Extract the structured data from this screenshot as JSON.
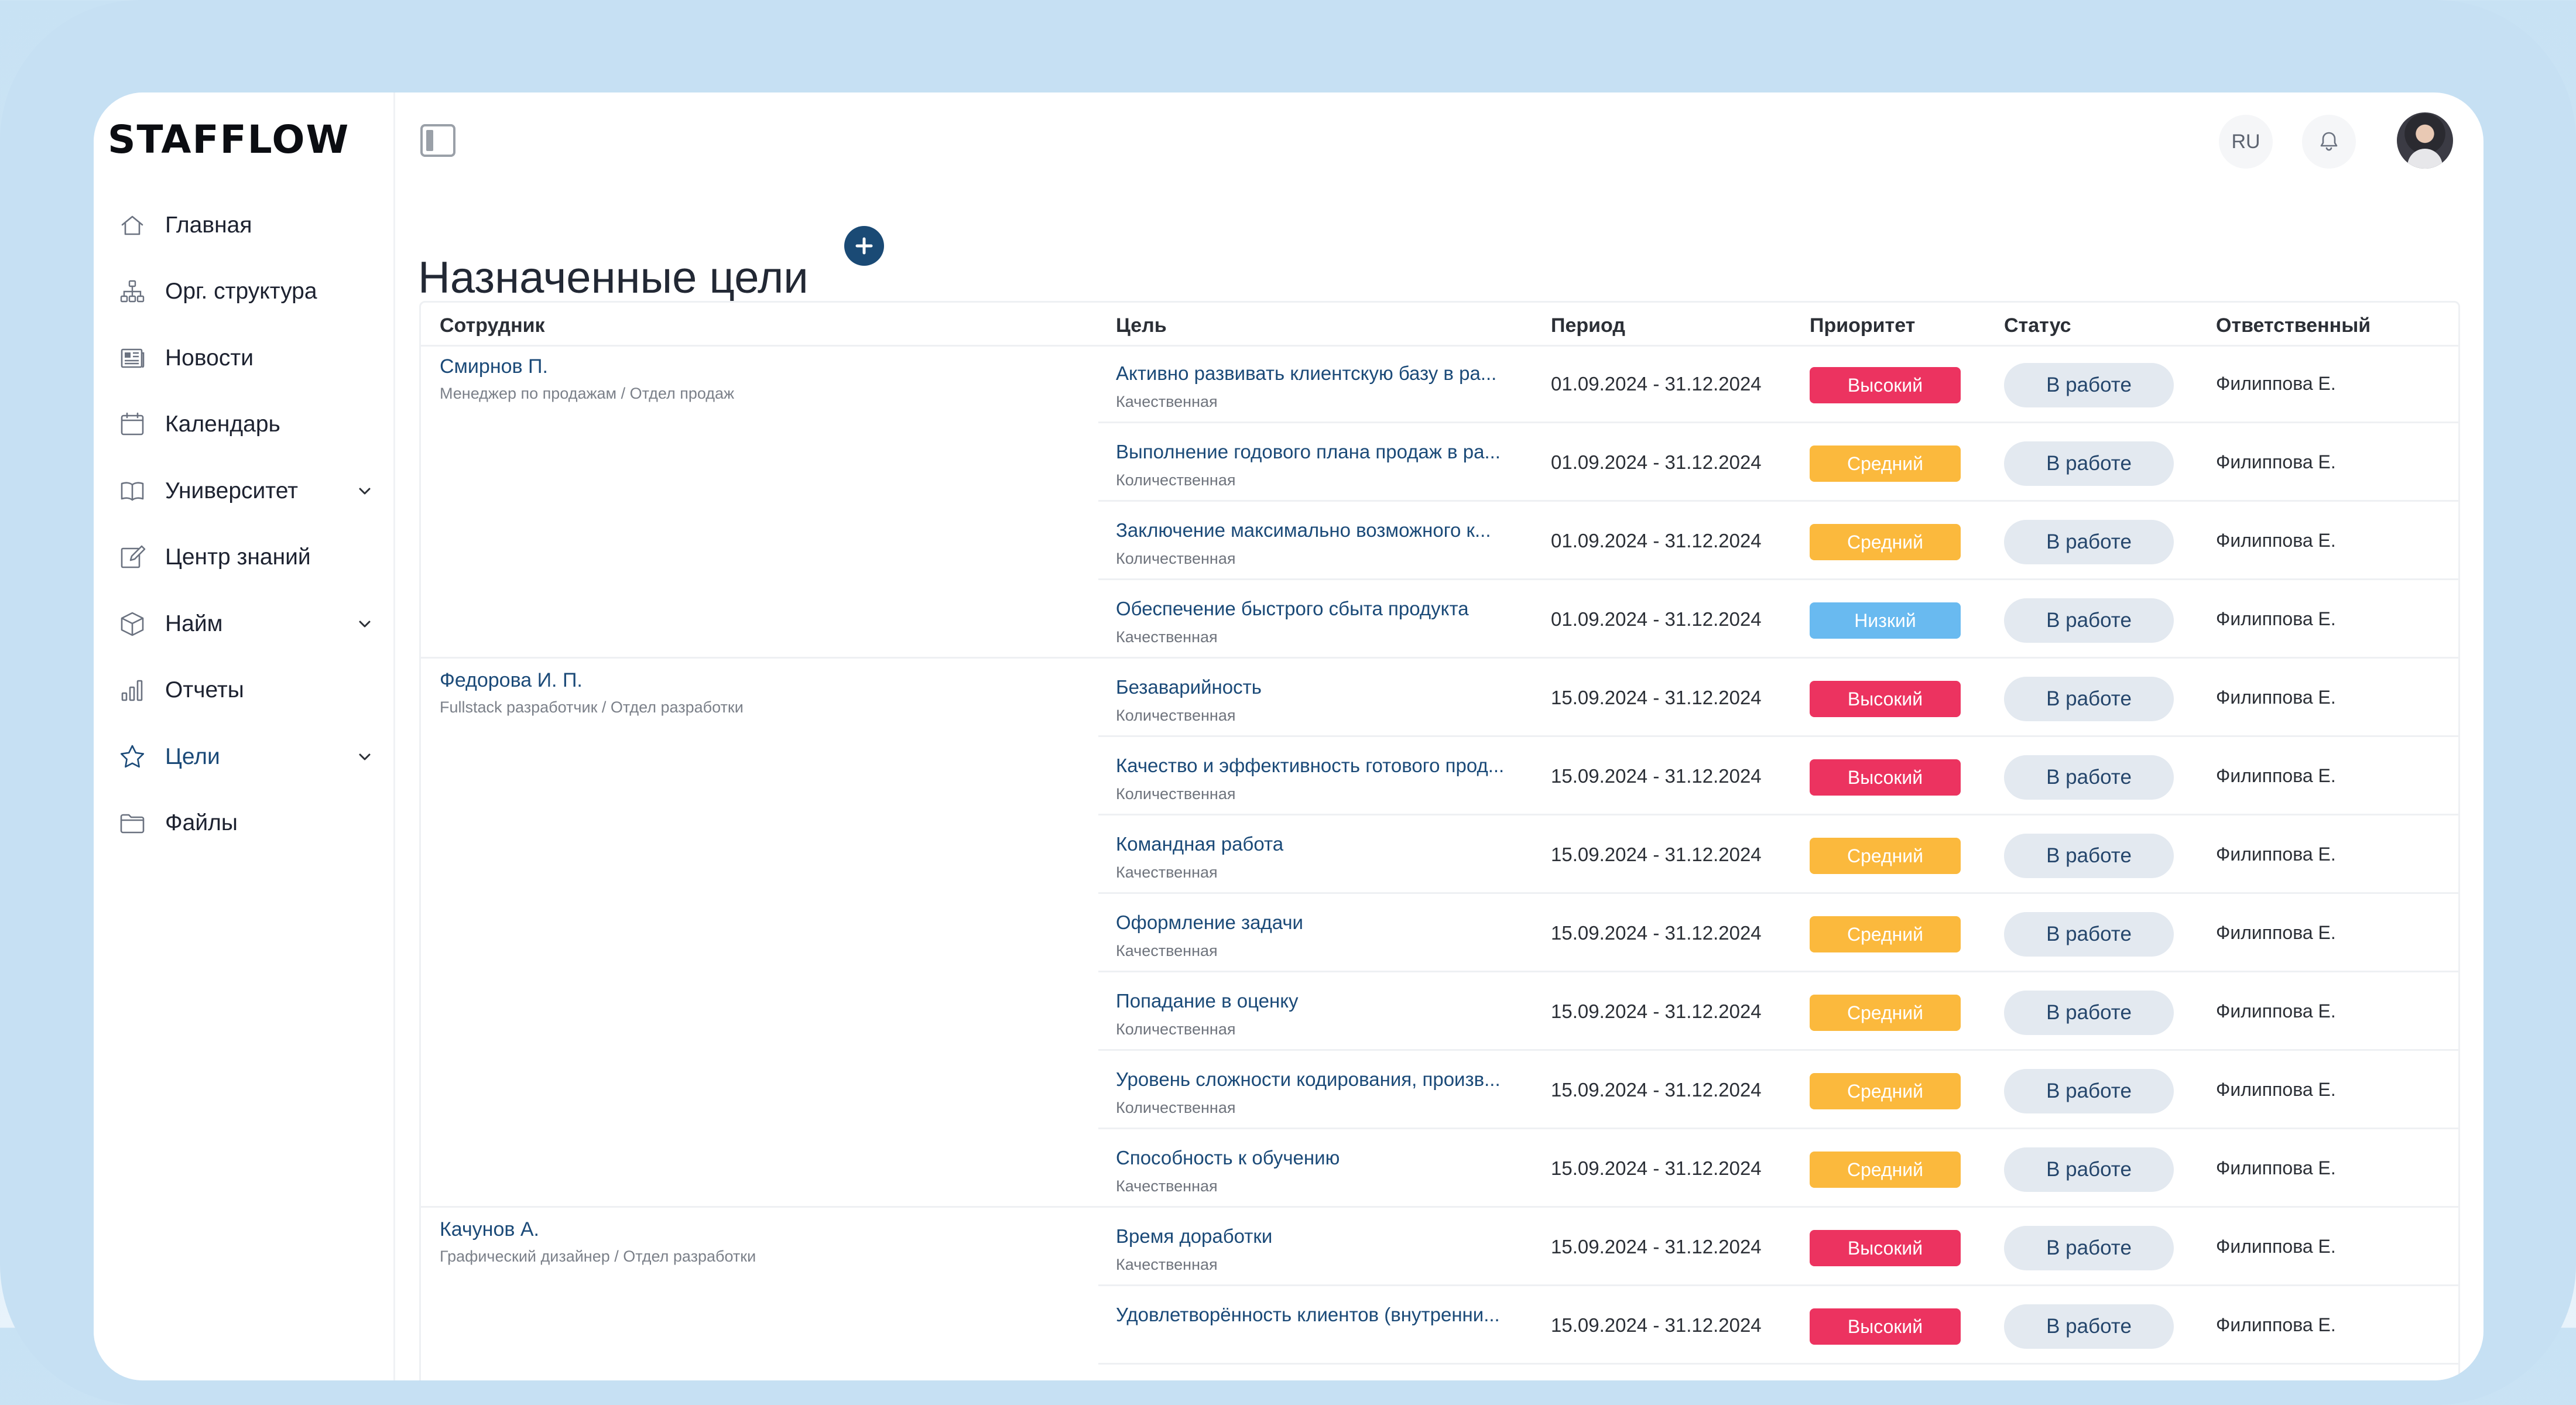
{
  "app": {
    "logo": "STAFFLOW",
    "language": "RU"
  },
  "sidebar": {
    "items": [
      {
        "label": "Главная",
        "icon": "home-icon"
      },
      {
        "label": "Орг. структура",
        "icon": "org-structure-icon"
      },
      {
        "label": "Новости",
        "icon": "newspaper-icon"
      },
      {
        "label": "Календарь",
        "icon": "calendar-icon"
      },
      {
        "label": "Университет",
        "icon": "book-icon",
        "expandable": true
      },
      {
        "label": "Центр знаний",
        "icon": "edit-icon"
      },
      {
        "label": "Найм",
        "icon": "box-icon",
        "expandable": true
      },
      {
        "label": "Отчеты",
        "icon": "bar-chart-icon"
      },
      {
        "label": "Цели",
        "icon": "star-icon",
        "expandable": true,
        "active": true
      },
      {
        "label": "Файлы",
        "icon": "folder-icon"
      }
    ]
  },
  "page": {
    "title": "Назначенные цели"
  },
  "table": {
    "columns": [
      "Сотрудник",
      "Цель",
      "Период",
      "Приоритет",
      "Статус",
      "Ответственный"
    ],
    "rows": [
      {
        "employee": "Смирнов П.",
        "role": "Менеджер по продажам / Отдел продаж",
        "goal": "Активно развивать клиентскую базу в ра...",
        "type": "Качественная",
        "period": "01.09.2024 - 31.12.2024",
        "priority": "Высокий",
        "priority_level": "high",
        "status": "В работе",
        "responsible": "Филиппова Е."
      },
      {
        "employee": "",
        "role": "",
        "goal": "Выполнение годового плана продаж в ра...",
        "type": "Количественная",
        "period": "01.09.2024 - 31.12.2024",
        "priority": "Средний",
        "priority_level": "mid",
        "status": "В работе",
        "responsible": "Филиппова Е."
      },
      {
        "employee": "",
        "role": "",
        "goal": "Заключение максимально возможного к...",
        "type": "Количественная",
        "period": "01.09.2024 - 31.12.2024",
        "priority": "Средний",
        "priority_level": "mid",
        "status": "В работе",
        "responsible": "Филиппова Е."
      },
      {
        "employee": "",
        "role": "",
        "goal": "Обеспечение быстрого сбыта продукта",
        "type": "Качественная",
        "period": "01.09.2024 - 31.12.2024",
        "priority": "Низкий",
        "priority_level": "low",
        "status": "В работе",
        "responsible": "Филиппова Е."
      },
      {
        "employee": "Федорова И. П.",
        "role": "Fullstack разработчик / Отдел разработки",
        "goal": "Безаварийность",
        "type": "Количественная",
        "period": "15.09.2024 - 31.12.2024",
        "priority": "Высокий",
        "priority_level": "high",
        "status": "В работе",
        "responsible": "Филиппова Е."
      },
      {
        "employee": "",
        "role": "",
        "goal": "Качество и эффективность готового прод...",
        "type": "Количественная",
        "period": "15.09.2024 - 31.12.2024",
        "priority": "Высокий",
        "priority_level": "high",
        "status": "В работе",
        "responsible": "Филиппова Е."
      },
      {
        "employee": "",
        "role": "",
        "goal": "Командная работа",
        "type": "Качественная",
        "period": "15.09.2024 - 31.12.2024",
        "priority": "Средний",
        "priority_level": "mid",
        "status": "В работе",
        "responsible": "Филиппова Е."
      },
      {
        "employee": "",
        "role": "",
        "goal": "Оформление задачи",
        "type": "Качественная",
        "period": "15.09.2024 - 31.12.2024",
        "priority": "Средний",
        "priority_level": "mid",
        "status": "В работе",
        "responsible": "Филиппова Е."
      },
      {
        "employee": "",
        "role": "",
        "goal": "Попадание в оценку",
        "type": "Количественная",
        "period": "15.09.2024 - 31.12.2024",
        "priority": "Средний",
        "priority_level": "mid",
        "status": "В работе",
        "responsible": "Филиппова Е."
      },
      {
        "employee": "",
        "role": "",
        "goal": "Уровень сложности кодирования, произв...",
        "type": "Количественная",
        "period": "15.09.2024 - 31.12.2024",
        "priority": "Средний",
        "priority_level": "mid",
        "status": "В работе",
        "responsible": "Филиппова Е."
      },
      {
        "employee": "",
        "role": "",
        "goal": "Способность к обучению",
        "type": "Качественная",
        "period": "15.09.2024 - 31.12.2024",
        "priority": "Средний",
        "priority_level": "mid",
        "status": "В работе",
        "responsible": "Филиппова Е."
      },
      {
        "employee": "Качунов А.",
        "role": "Графический дизайнер / Отдел разработки",
        "goal": "Время доработки",
        "type": "Качественная",
        "period": "15.09.2024 - 31.12.2024",
        "priority": "Высокий",
        "priority_level": "high",
        "status": "В работе",
        "responsible": "Филиппова Е."
      },
      {
        "employee": "",
        "role": "",
        "goal": "Удовлетворённость клиентов (внутренни...",
        "type": "",
        "period": "15.09.2024 - 31.12.2024",
        "priority": "Высокий",
        "priority_level": "high",
        "status": "В работе",
        "responsible": "Филиппова Е."
      }
    ]
  }
}
